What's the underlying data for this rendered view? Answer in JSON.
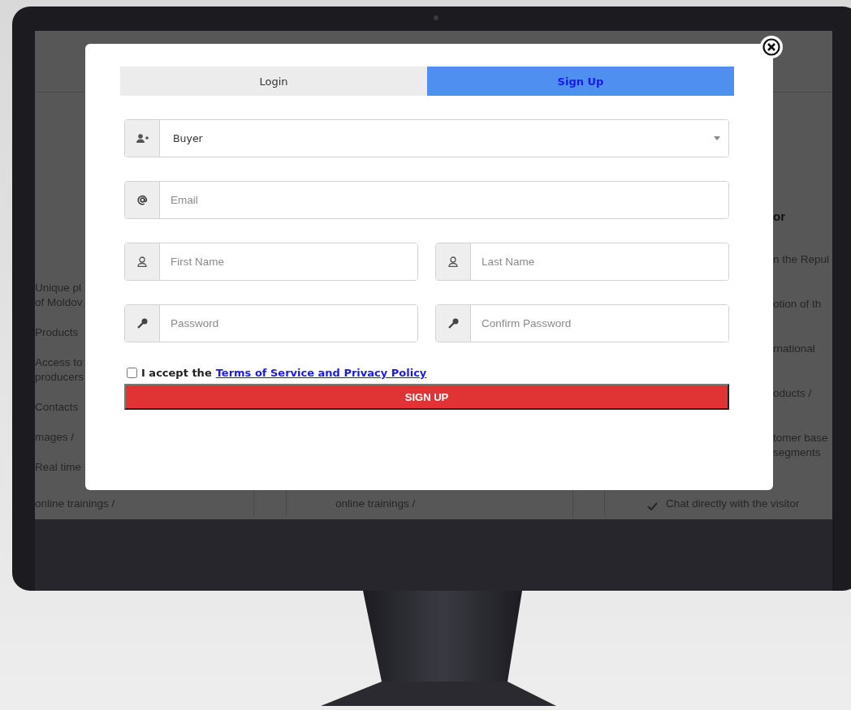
{
  "background_page": {
    "left_column": [
      [
        "Unique pl",
        "of Moldov"
      ],
      [
        "Products"
      ],
      [
        "Access to",
        "producers"
      ],
      [
        "Contacts"
      ],
      [
        "mages /"
      ],
      [
        "Real time"
      ]
    ],
    "right_column": {
      "heading": "or",
      "groups": [
        [
          "n the Repul"
        ],
        [
          "otion of th"
        ],
        [
          "rnational"
        ],
        [
          "oducts /"
        ],
        [
          "tomer base",
          "segments"
        ]
      ]
    },
    "bottom": [
      {
        "text": "online trainings /",
        "checked": false
      },
      {
        "text": "online trainings /",
        "checked": false
      },
      {
        "text": "Chat directly with the visitor",
        "checked": true
      }
    ]
  },
  "modal": {
    "tabs": [
      {
        "label": "Login",
        "selected": false
      },
      {
        "label": "Sign Up",
        "selected": true
      }
    ],
    "account_type": {
      "value": "Buyer"
    },
    "email": {
      "placeholder": "Email"
    },
    "first_name": {
      "placeholder": "First Name"
    },
    "last_name": {
      "placeholder": "Last Name"
    },
    "password": {
      "placeholder": "Password"
    },
    "confirm_password": {
      "placeholder": "Confirm Password"
    },
    "terms": {
      "checked": false,
      "text": "I accept the",
      "link": "Terms of Service and Privacy Policy"
    },
    "submit": "SIGN UP"
  }
}
